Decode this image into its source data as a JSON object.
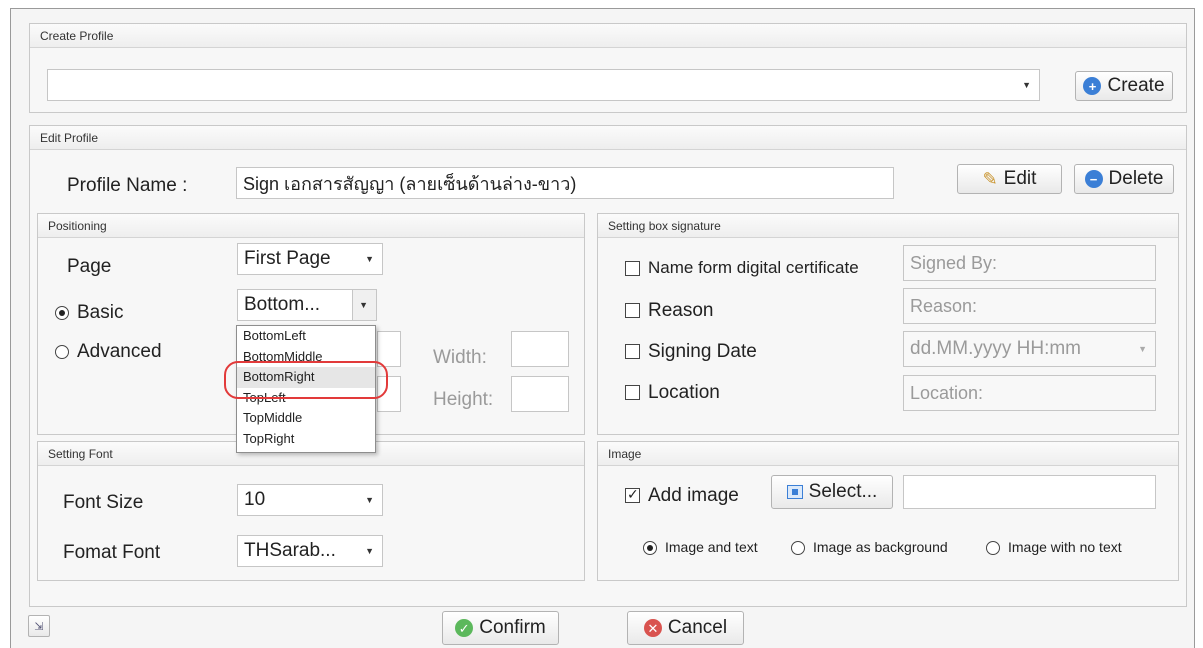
{
  "create_profile": {
    "title": "Create Profile",
    "combo_value": "",
    "create_label": "Create"
  },
  "edit_profile": {
    "title": "Edit Profile",
    "profile_name_label": "Profile Name :",
    "profile_name_value": "Sign เอกสารสัญญา (ลายเซ็นด้านล่าง-ขาว)",
    "edit_label": "Edit",
    "delete_label": "Delete"
  },
  "positioning": {
    "title": "Positioning",
    "page_label": "Page",
    "page_value": "First Page",
    "basic_label": "Basic",
    "basic_value": "Bottom...",
    "advanced_label": "Advanced",
    "width_label": "Width:",
    "height_label": "Height:",
    "options": [
      "BottomLeft",
      "BottomMiddle",
      "BottomRight",
      "TopLeft",
      "TopMiddle",
      "TopRight"
    ],
    "selected_option": "BottomRight"
  },
  "signature_box": {
    "title": "Setting box signature",
    "name_cert_label": "Name form digital certificate",
    "name_cert_placeholder": "Signed By:",
    "reason_label": "Reason",
    "reason_placeholder": "Reason:",
    "signing_date_label": "Signing Date",
    "signing_date_value": "dd.MM.yyyy HH:mm",
    "location_label": "Location",
    "location_placeholder": "Location:"
  },
  "font": {
    "title": "Setting Font",
    "size_label": "Font Size",
    "size_value": "10",
    "format_label": "Fomat Font",
    "format_value": "THSarab..."
  },
  "image": {
    "title": "Image",
    "add_image_label": "Add image",
    "select_label": "Select...",
    "path_value": "",
    "opt_image_text": "Image and text",
    "opt_image_bg": "Image as background",
    "opt_image_notext": "Image with no text"
  },
  "footer": {
    "confirm_label": "Confirm",
    "cancel_label": "Cancel"
  },
  "colors": {
    "create_icon": "#3b7fd6",
    "delete_icon": "#3b7fd6",
    "confirm_icon": "#5cb85c",
    "cancel_icon": "#d9534f",
    "highlight": "#e23a3a"
  }
}
